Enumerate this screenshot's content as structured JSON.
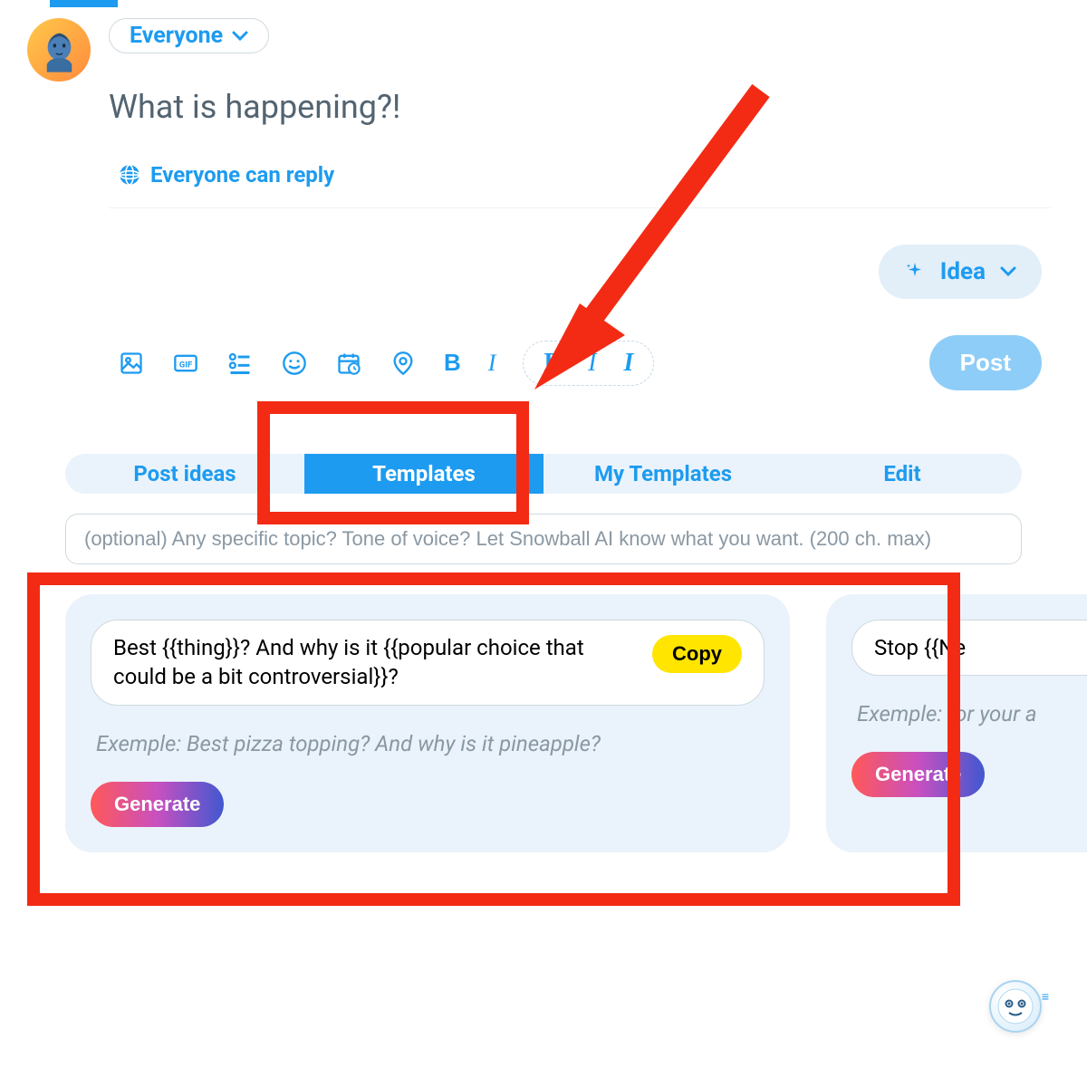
{
  "composer": {
    "audience_label": "Everyone",
    "placeholder": "What is happening?!",
    "reply_label": "Everyone can reply"
  },
  "idea_pill": {
    "label": "Idea"
  },
  "post_button": "Post",
  "tabs": {
    "post_ideas": "Post ideas",
    "templates": "Templates",
    "my_templates": "My Templates",
    "edit": "Edit"
  },
  "topic_input": {
    "placeholder": "(optional) Any specific topic? Tone of voice? Let Snowball AI know what you want. (200 ch. max)"
  },
  "cards": {
    "card1": {
      "template_text": "Best {{thing}}? And why is it {{popular choice that could be a bit controversial}}?",
      "copy_label": "Copy",
      "example": "Exemple: Best pizza topping? And why is it pineapple?",
      "generate": "Generate"
    },
    "card2": {
      "template_text": "Stop {{Ne",
      "example": "Exemple: for your a",
      "generate": "Generate"
    }
  }
}
